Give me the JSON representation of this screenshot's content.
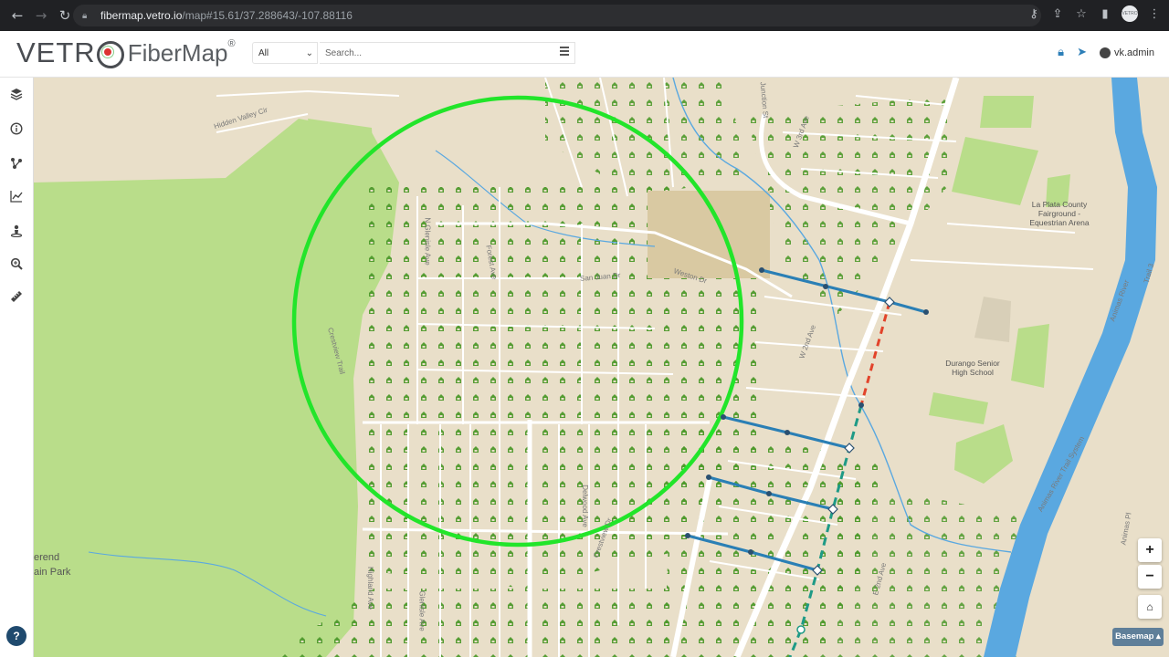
{
  "browser": {
    "url_host": "fibermap.vetro.io",
    "url_path": "/map#15.61/37.288643/-107.88116",
    "profile_label": "VETRO"
  },
  "header": {
    "logo_text_1": "VETR",
    "logo_text_2": "FiberMap",
    "logo_reg": "®",
    "filter_value": "All",
    "search_placeholder": "Search...",
    "user_name": "vk.admin"
  },
  "left_toolbar": {
    "tools": [
      "layers-icon",
      "info-icon",
      "network-trace-icon",
      "analytics-icon",
      "service-location-icon",
      "zoom-search-icon",
      "measure-icon"
    ]
  },
  "map": {
    "street_labels": [
      "Hidden Valley Cir",
      "N Glenisle Ave",
      "Forest Ave",
      "San Juan Dr",
      "Weston Dr",
      "Junction St",
      "W 3rd Ave",
      "W 2nd Ave",
      "Crestview Trail",
      "Highland Ave",
      "Glenisle Ave",
      "Delwood Ave",
      "Crestview Dr",
      "E 2nd Ave",
      "Animas River Trail System",
      "Animas River",
      "Animas Pl",
      "Trail 3"
    ],
    "poi_labels": {
      "fairground": "La Plata County Fairground - Equestrian Arena",
      "school": "Durango Senior High School",
      "park_line1": "erend",
      "park_line2": "ain Park"
    },
    "colors": {
      "selection_circle": "#22e52a",
      "fiber_blue": "#2a7fb5",
      "fiber_red": "#e2432a",
      "fiber_teal": "#1e9a86",
      "green_space": "#b9dd8a",
      "river": "#5aa8e0"
    }
  },
  "controls": {
    "zoom_in": "+",
    "zoom_out": "−",
    "basemap_label": "Basemap ▴"
  }
}
